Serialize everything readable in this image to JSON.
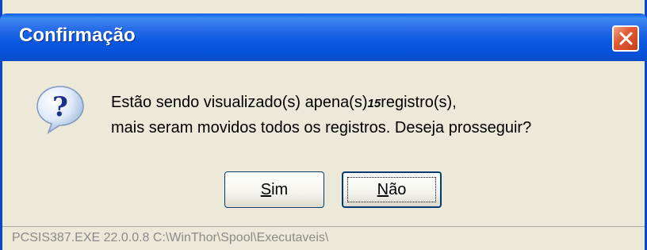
{
  "window": {
    "title": "Confirmação",
    "close_icon": "close-icon"
  },
  "dialog": {
    "icon": "question-icon",
    "message_line1_prefix": "Estão sendo visualizado(s) apena(s)",
    "message_line1_count": "15",
    "message_line1_suffix": "registro(s),",
    "message_line2": "mais seram movidos todos os registros. Deseja prosseguir?"
  },
  "buttons": {
    "yes_mnemonic": "S",
    "yes_rest": "im",
    "no_mnemonic": "N",
    "no_rest": "ão"
  },
  "statusbar": {
    "text": "PCSIS387.EXE 22.0.0.8  C:\\WinThor\\Spool\\Executaveis\\"
  },
  "colors": {
    "titlebar": "#0a58df",
    "close_button": "#e25b35",
    "dialog_bg": "#ece9d8"
  }
}
